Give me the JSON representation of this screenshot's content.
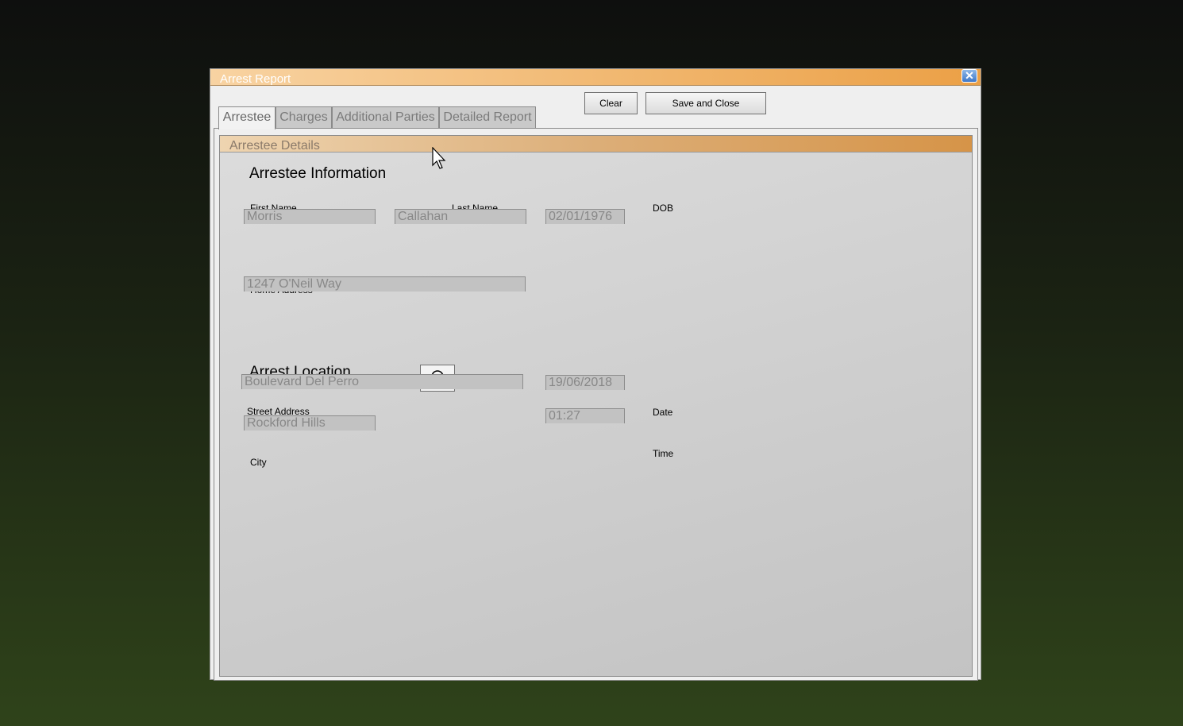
{
  "window": {
    "title": "Arrest Report",
    "close_icon": "close-icon"
  },
  "toolbar": {
    "clear_label": "Clear",
    "save_label": "Save and Close"
  },
  "tabs": [
    {
      "label": "Arrestee",
      "active": true
    },
    {
      "label": "Charges"
    },
    {
      "label": "Additional Parties"
    },
    {
      "label": "Detailed Report"
    }
  ],
  "group": {
    "title": "Arrestee Details"
  },
  "arrestee": {
    "heading": "Arrestee Information",
    "first_name_label": "First Name",
    "first_name": "Morris",
    "last_name_label": "Last Name",
    "last_name": "Callahan",
    "dob_label": "DOB",
    "dob": "02/01/1976",
    "home_address_label": "Home Address",
    "home_address": "1247 O'Neil Way"
  },
  "location": {
    "heading": "Arrest Location",
    "locate_icon": "location-icon",
    "street_label": "Street Address",
    "street": "Boulevard Del Perro",
    "city_label": "City",
    "city": "Rockford Hills",
    "date_label": "Date",
    "date": "19/06/2018",
    "time_label": "Time",
    "time": "01:27"
  },
  "colors": {
    "title_accent": "#eba046",
    "header_accent": "#d69448"
  }
}
